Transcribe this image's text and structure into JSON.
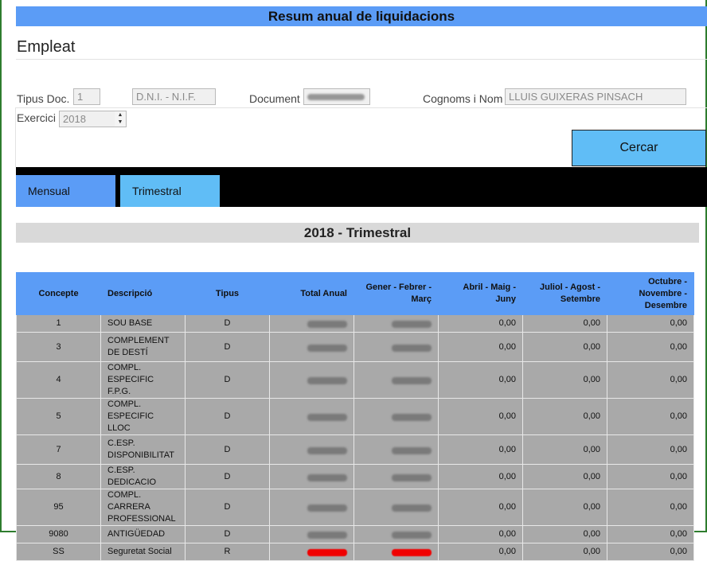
{
  "page": {
    "title": "Resum anual de liquidacions"
  },
  "employee_section": {
    "title": "Empleat",
    "doc_type_label": "Tipus Doc.",
    "doc_type_value": "1",
    "dni_placeholder": "D.N.I. - N.I.F.",
    "document_label": "Document",
    "name_label": "Cognoms i Nom",
    "name_value": "LLUIS GUIXERAS PINSACH",
    "year_label": "Exercici",
    "year_value": "2018",
    "search_button": "Cercar"
  },
  "tabs": [
    {
      "label": "Mensual"
    },
    {
      "label": "Trimestral"
    }
  ],
  "period_heading": "2018 - Trimestral",
  "table": {
    "headers": [
      "Concepte",
      "Descripció",
      "Tipus",
      "Total Anual",
      "Gener - Febrer - Març",
      "Abril - Maig - Juny",
      "Juliol - Agost - Setembre",
      "Octubre - Novembre - Desembre"
    ],
    "rows": [
      {
        "concepte": "1",
        "descripcio": "SOU BASE",
        "tipus": "D",
        "q2": "0,00",
        "q3": "0,00",
        "q4": "0,00",
        "red": false
      },
      {
        "concepte": "3",
        "descripcio": "COMPLEMENT DE DESTÍ",
        "tipus": "D",
        "q2": "0,00",
        "q3": "0,00",
        "q4": "0,00",
        "red": false
      },
      {
        "concepte": "4",
        "descripcio": "COMPL. ESPECIFIC F.P.G.",
        "tipus": "D",
        "q2": "0,00",
        "q3": "0,00",
        "q4": "0,00",
        "red": false
      },
      {
        "concepte": "5",
        "descripcio": "COMPL. ESPECIFIC LLOC",
        "tipus": "D",
        "q2": "0,00",
        "q3": "0,00",
        "q4": "0,00",
        "red": false
      },
      {
        "concepte": "7",
        "descripcio": "C.ESP. DISPONIBILITAT",
        "tipus": "D",
        "q2": "0,00",
        "q3": "0,00",
        "q4": "0,00",
        "red": false
      },
      {
        "concepte": "8",
        "descripcio": "C.ESP. DEDICACIO",
        "tipus": "D",
        "q2": "0,00",
        "q3": "0,00",
        "q4": "0,00",
        "red": false
      },
      {
        "concepte": "95",
        "descripcio": "COMPL. CARRERA PROFESSIONAL",
        "tipus": "D",
        "q2": "0,00",
        "q3": "0,00",
        "q4": "0,00",
        "red": false
      },
      {
        "concepte": "9080",
        "descripcio": "ANTIGÜEDAD",
        "tipus": "D",
        "q2": "0,00",
        "q3": "0,00",
        "q4": "0,00",
        "red": false
      },
      {
        "concepte": "SS",
        "descripcio": "Seguretat Social",
        "tipus": "R",
        "q2": "0,00",
        "q3": "0,00",
        "q4": "0,00",
        "red": true
      }
    ]
  }
}
